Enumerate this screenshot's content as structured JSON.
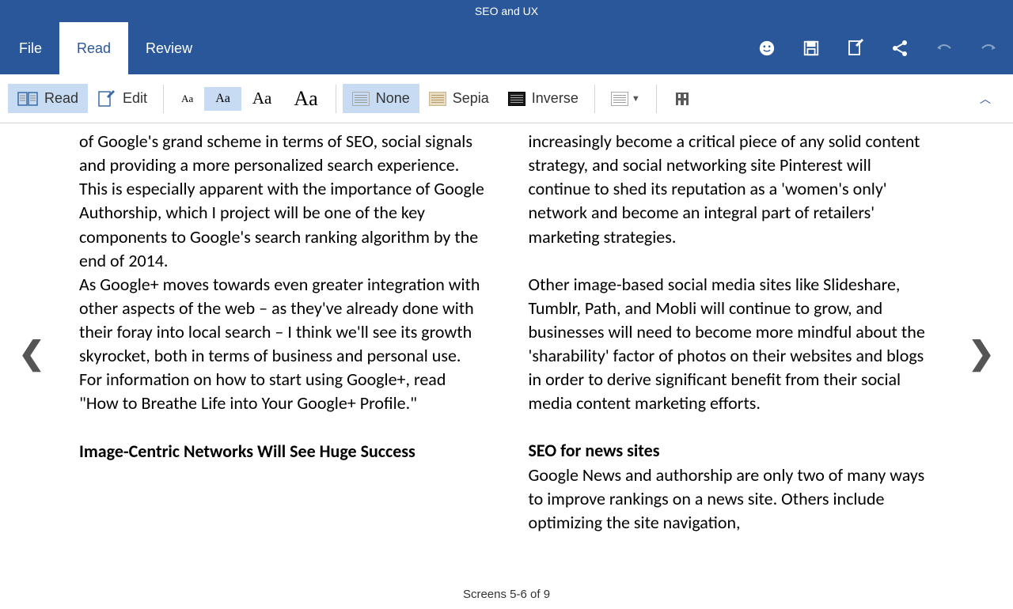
{
  "title": "SEO and UX",
  "tabs": {
    "file": "File",
    "read": "Read",
    "review": "Review"
  },
  "toolbar": {
    "read": "Read",
    "edit": "Edit",
    "font_aa": "Aa",
    "none": "None",
    "sepia": "Sepia",
    "inverse": "Inverse"
  },
  "content": {
    "left": {
      "p1": "of Google's grand scheme in terms of SEO, social signals and providing a more personalized search experience. This is especially apparent with the importance of Google Authorship, which I project will be one of the key components to Google's search ranking algorithm by the end of 2014.",
      "p2": "As Google+ moves towards even greater integration with other aspects of the web – as they've already done with their foray into local search – I think we'll see its growth skyrocket, both in terms of business and personal use. For information on how to start using Google+, read \"How to Breathe Life into Your Google+ Profile.\"",
      "h1": "Image-Centric Networks Will See Huge Success"
    },
    "right": {
      "p1": "increasingly become a critical piece of any solid content strategy, and social networking site Pinterest will continue to shed its reputation as a 'women's only' network and become an integral part of retailers' marketing strategies.",
      "p2": "Other image-based social media sites like Slideshare, Tumblr, Path, and Mobli will continue to grow, and businesses will need to become more mindful about the 'sharability' factor of photos on their websites and blogs in order to derive significant benefit from their social media content marketing efforts.",
      "h1": "SEO for news sites",
      "p3": "Google News and authorship are only two of many ways to improve rankings on a news site. Others include optimizing the site navigation,"
    }
  },
  "footer": "Screens 5-6 of 9"
}
